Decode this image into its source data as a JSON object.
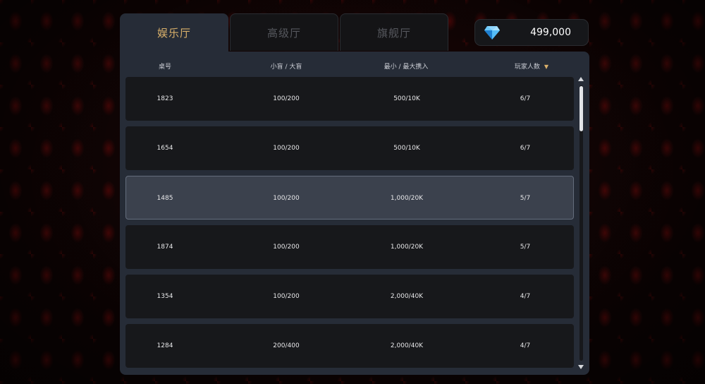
{
  "tabs": [
    {
      "label": "娱乐厅",
      "active": true
    },
    {
      "label": "高级厅",
      "active": false
    },
    {
      "label": "旗舰厅",
      "active": false
    }
  ],
  "balance": {
    "icon": "diamond-icon",
    "amount": "499,000"
  },
  "columns": {
    "table_no": "桌号",
    "blinds": "小盲 / 大盲",
    "buy_in": "最小 / 最大携入",
    "players": "玩家人数",
    "sort_icon": "▼"
  },
  "rows": [
    {
      "table_no": "1823",
      "blinds": "100/200",
      "buy_in": "500/10K",
      "players": "6/7"
    },
    {
      "table_no": "1654",
      "blinds": "100/200",
      "buy_in": "500/10K",
      "players": "6/7"
    },
    {
      "table_no": "1485",
      "blinds": "100/200",
      "buy_in": "1,000/20K",
      "players": "5/7"
    },
    {
      "table_no": "1874",
      "blinds": "100/200",
      "buy_in": "1,000/20K",
      "players": "5/7"
    },
    {
      "table_no": "1354",
      "blinds": "100/200",
      "buy_in": "2,000/40K",
      "players": "4/7"
    },
    {
      "table_no": "1284",
      "blinds": "200/400",
      "buy_in": "2,000/40K",
      "players": "4/7"
    }
  ],
  "selected_row": 2,
  "colors": {
    "accent": "#d9b06a",
    "panel": "#262c37",
    "row": "#17181b",
    "selected_row": "#3b414d"
  }
}
